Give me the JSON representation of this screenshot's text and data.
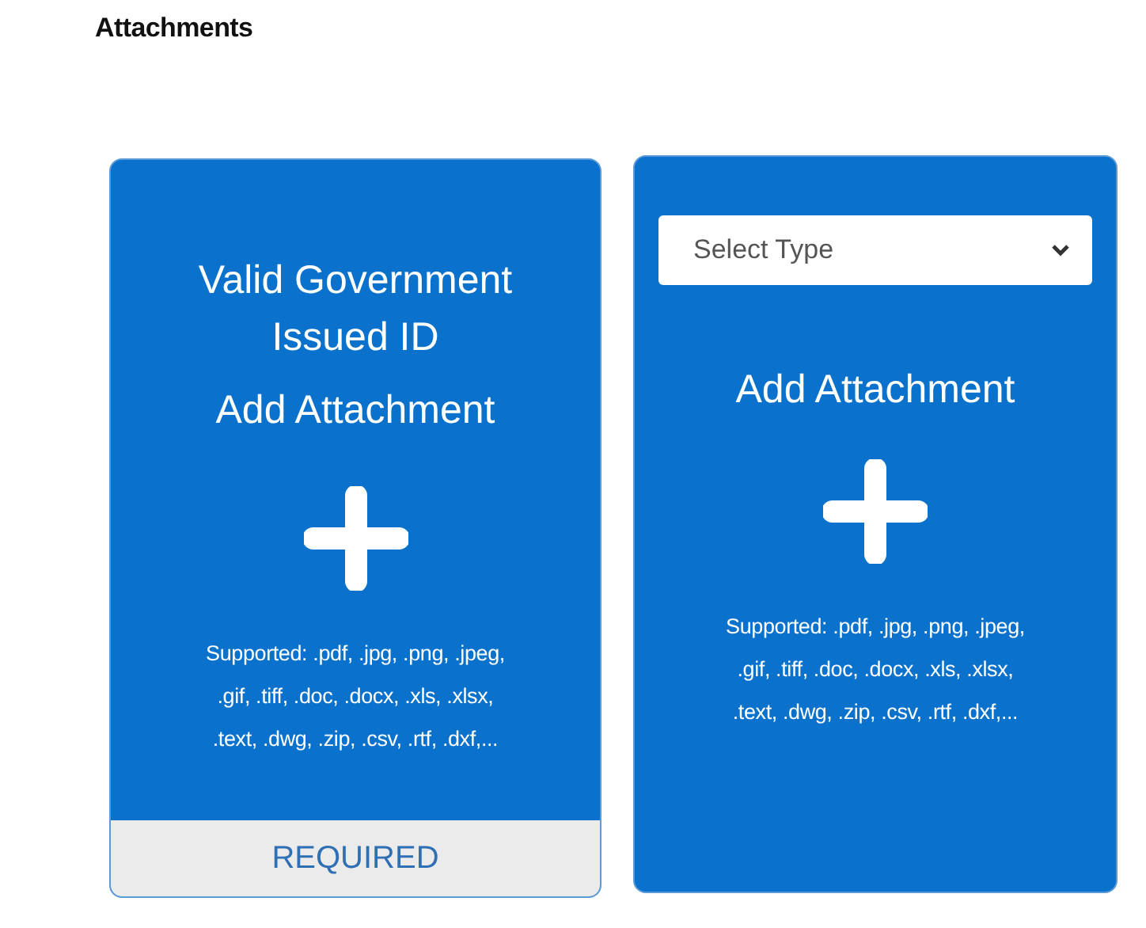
{
  "heading": "Attachments",
  "cards": [
    {
      "kind": "named",
      "title": "Valid Government Issued ID",
      "action": "Add Attachment",
      "supported_lines": [
        "Supported: .pdf, .jpg, .png, .jpeg,",
        ".gif, .tiff, .doc, .docx, .xls, .xlsx,",
        ".text, .dwg, .zip, .csv, .rtf, .dxf,..."
      ],
      "footer": "REQUIRED"
    },
    {
      "kind": "typed",
      "select": {
        "value": "Select Type"
      },
      "action": "Add Attachment",
      "supported_lines": [
        "Supported: .pdf, .jpg, .png, .jpeg,",
        ".gif, .tiff, .doc, .docx, .xls, .xlsx,",
        ".text, .dwg, .zip, .csv, .rtf, .dxf,..."
      ]
    }
  ]
}
